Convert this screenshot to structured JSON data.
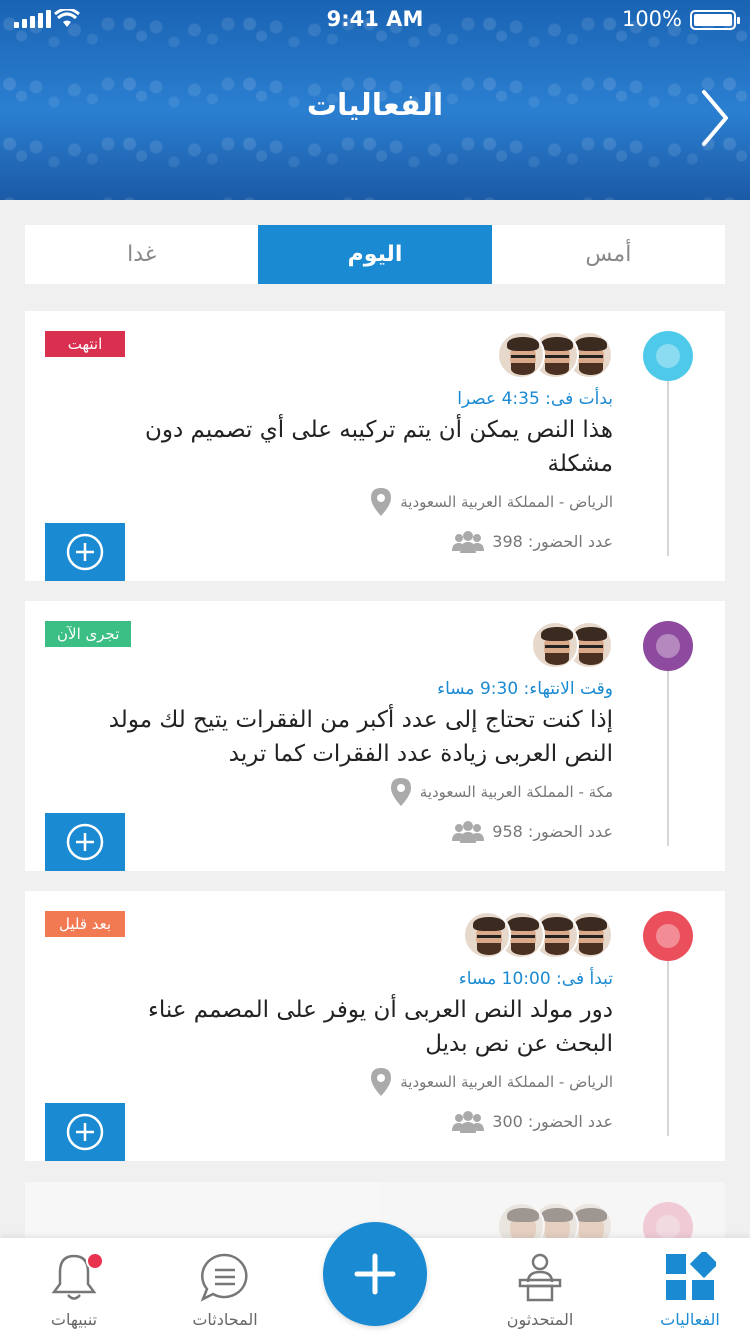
{
  "status_bar": {
    "time": "9:41 AM",
    "battery": "100%",
    "battery_level": 1.0
  },
  "header": {
    "title": "الفعاليات"
  },
  "tabs": [
    {
      "label": "أمس",
      "active": false
    },
    {
      "label": "اليوم",
      "active": true
    },
    {
      "label": "غدا",
      "active": false
    }
  ],
  "events": [
    {
      "status": "انتهت",
      "status_color": "#d9304f",
      "dot_color": "#4fc9ea",
      "time_label": "بدأت فى: 4:35 عصرا",
      "title": "هذا النص يمكن أن يتم تركيبه على أي تصميم دون مشكلة",
      "location": "الرياض - المملكة العربية السعودية",
      "attendance": "عدد الحضور: 398",
      "avatar_count": 3
    },
    {
      "status": "تجرى الآن",
      "status_color": "#3bbf84",
      "dot_color": "#8e4a9e",
      "time_label": "وقت الانتهاء: 9:30 مساء",
      "title": "إذا كنت تحتاج إلى عدد أكبر من الفقرات يتيح لك مولد النص العربى زيادة عدد الفقرات كما تريد",
      "location": "مكة - المملكة العربية السعودية",
      "attendance": "عدد الحضور: 958",
      "avatar_count": 2
    },
    {
      "status": "بعد قليل",
      "status_color": "#f27a52",
      "dot_color": "#ec4f5c",
      "time_label": "تبدأ فى: 10:00 مساء",
      "title": "دور مولد النص العربى أن يوفر على المصمم عناء البحث عن نص بديل",
      "location": "الرياض - المملكة العربية السعودية",
      "attendance": "عدد الحضور: 300",
      "avatar_count": 4
    }
  ],
  "bottom_nav": {
    "events": "الفعاليات",
    "speakers": "المتحدثون",
    "chats": "المحادثات",
    "notifications": "تنبيهات"
  },
  "colors": {
    "accent": "#1a8ad2"
  }
}
